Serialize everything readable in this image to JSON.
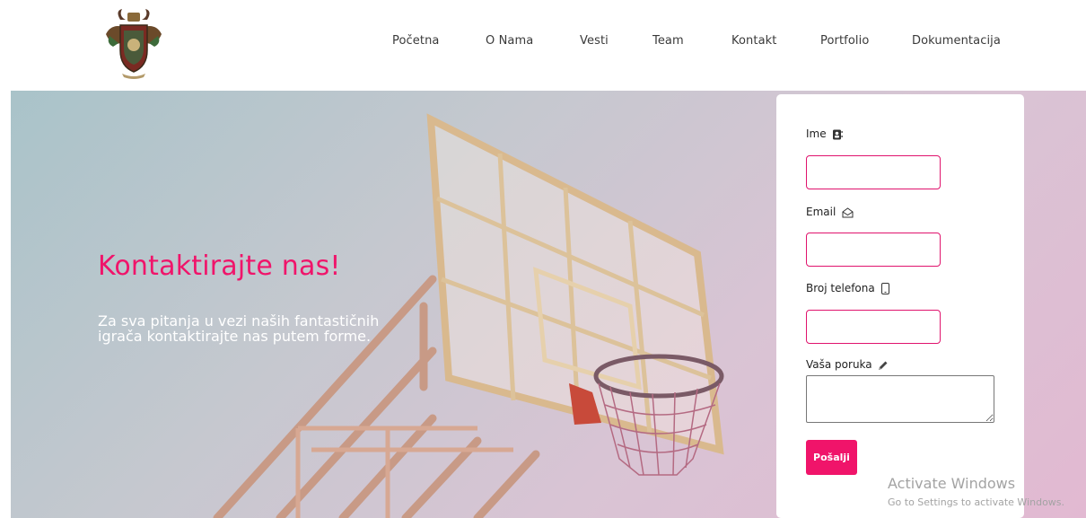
{
  "header": {
    "logo_icon": "coat-of-arms-logo",
    "nav": [
      {
        "label": "Početna"
      },
      {
        "label": "O Nama"
      },
      {
        "label": "Vesti"
      },
      {
        "label": "Team"
      },
      {
        "label": "Kontakt"
      },
      {
        "label": "Portfolio"
      },
      {
        "label": "Dokumentacija"
      }
    ]
  },
  "hero": {
    "title": "Kontaktirajte nas!",
    "text": "Za sva pitanja u vezi naših fantastičnih igrača kontaktirajte nas putem forme.",
    "background_icon": "basketball-hoop-image",
    "accent_color": "#f0146a"
  },
  "form": {
    "name_label": "Ime",
    "name_icon": "address-book-icon",
    "name_value": "",
    "email_label": "Email",
    "email_icon": "envelope-open-icon",
    "email_value": "",
    "phone_label": "Broj telefona",
    "phone_icon": "mobile-phone-icon",
    "phone_value": "",
    "message_label": "Vaša poruka",
    "message_icon": "pencil-icon",
    "message_value": "",
    "submit_label": "Pošalji"
  },
  "watermark": {
    "title": "Activate Windows",
    "subtitle": "Go to Settings to activate Windows."
  }
}
